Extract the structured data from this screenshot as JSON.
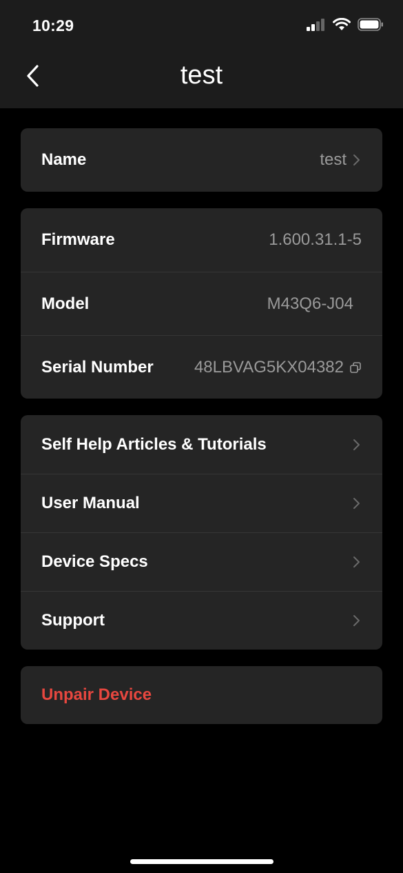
{
  "status_bar": {
    "time": "10:29"
  },
  "nav": {
    "title": "test"
  },
  "name_card": {
    "label": "Name",
    "value": "test"
  },
  "info_card": {
    "firmware_label": "Firmware",
    "firmware_value": "1.600.31.1-5",
    "model_label": "Model",
    "model_value": "M43Q6-J04",
    "serial_label": "Serial Number",
    "serial_value": "48LBVAG5KX04382"
  },
  "help_card": {
    "items": [
      {
        "label": "Self Help Articles & Tutorials"
      },
      {
        "label": "User Manual"
      },
      {
        "label": "Device Specs"
      },
      {
        "label": "Support"
      }
    ]
  },
  "unpair": {
    "label": "Unpair Device",
    "color": "#e8473f"
  },
  "icons": [
    "signal-icon",
    "wifi-icon",
    "battery-icon",
    "back-chevron-icon",
    "chevron-right-icon",
    "copy-icon"
  ]
}
